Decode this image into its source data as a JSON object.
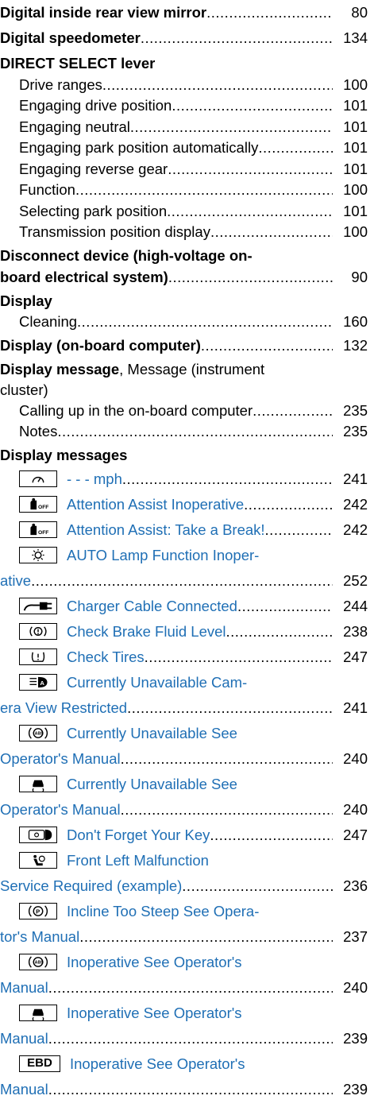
{
  "entries": [
    {
      "kind": "main",
      "parts": [
        {
          "t": "Digital inside rear view mirror",
          "b": true
        }
      ],
      "page": "80"
    },
    {
      "kind": "main",
      "parts": [
        {
          "t": "Digital speedometer",
          "b": true
        }
      ],
      "page": "134"
    },
    {
      "kind": "main",
      "parts": [
        {
          "t": "DIRECT SELECT lever",
          "b": true
        }
      ],
      "page": ""
    },
    {
      "kind": "sub",
      "parts": [
        {
          "t": "Drive ranges"
        }
      ],
      "page": "100"
    },
    {
      "kind": "sub",
      "parts": [
        {
          "t": "Engaging drive position"
        }
      ],
      "page": "101"
    },
    {
      "kind": "sub",
      "parts": [
        {
          "t": "Engaging neutral"
        }
      ],
      "page": "101"
    },
    {
      "kind": "sub",
      "parts": [
        {
          "t": "Engaging park position automatically"
        }
      ],
      "page": "101"
    },
    {
      "kind": "sub",
      "parts": [
        {
          "t": "Engaging reverse gear"
        }
      ],
      "page": "101"
    },
    {
      "kind": "sub",
      "parts": [
        {
          "t": "Function"
        }
      ],
      "page": "100"
    },
    {
      "kind": "sub",
      "parts": [
        {
          "t": "Selecting park position"
        }
      ],
      "page": "101"
    },
    {
      "kind": "sub",
      "parts": [
        {
          "t": "Transmission position display"
        }
      ],
      "page": "100"
    },
    {
      "kind": "main",
      "parts": [
        {
          "t": "Disconnect device (high-voltage on-",
          "b": true
        }
      ],
      "page": ""
    },
    {
      "kind": "main",
      "parts": [
        {
          "t": "board electrical system)",
          "b": true
        }
      ],
      "page": "90"
    },
    {
      "kind": "main",
      "parts": [
        {
          "t": "Display",
          "b": true
        }
      ],
      "page": ""
    },
    {
      "kind": "sub",
      "parts": [
        {
          "t": "Cleaning"
        }
      ],
      "page": "160"
    },
    {
      "kind": "main",
      "parts": [
        {
          "t": "Display (on-board computer)",
          "b": true
        }
      ],
      "page": "132"
    },
    {
      "kind": "main",
      "parts": [
        {
          "t": "Display message",
          "b": true
        },
        {
          "t": ", Message (instrument"
        }
      ],
      "page": ""
    },
    {
      "kind": "main",
      "parts": [
        {
          "t": "cluster)"
        }
      ],
      "page": ""
    },
    {
      "kind": "sub",
      "parts": [
        {
          "t": "Calling up in the on-board computer"
        }
      ],
      "page": "235"
    },
    {
      "kind": "sub",
      "parts": [
        {
          "t": "Notes"
        }
      ],
      "page": "235"
    },
    {
      "kind": "main",
      "parts": [
        {
          "t": "Display messages",
          "b": true
        }
      ],
      "page": ""
    },
    {
      "kind": "msg",
      "icon": "speedometer-icon",
      "parts": [
        {
          "t": "- - - mph",
          "l": true
        }
      ],
      "page": "241"
    },
    {
      "kind": "msg",
      "icon": "attention-assist-off-icon",
      "parts": [
        {
          "t": "Attention Assist Inoperative",
          "l": true
        }
      ],
      "page": "242"
    },
    {
      "kind": "msg",
      "icon": "attention-assist-off-icon",
      "parts": [
        {
          "t": "Attention Assist: Take a Break!",
          "l": true
        }
      ],
      "page": "242"
    },
    {
      "kind": "msg",
      "icon": "lamp-icon",
      "parts": [
        {
          "t": "AUTO Lamp Function Inoper-",
          "l": true
        }
      ],
      "page": ""
    },
    {
      "kind": "cont",
      "parts": [
        {
          "t": "ative",
          "l": true
        }
      ],
      "page": "252"
    },
    {
      "kind": "msg",
      "icon": "charger-plug-icon",
      "parts": [
        {
          "t": "Charger Cable Connected",
          "l": true
        }
      ],
      "page": "244"
    },
    {
      "kind": "msg",
      "icon": "brake-warning-icon",
      "parts": [
        {
          "t": "Check Brake Fluid Level",
          "l": true
        }
      ],
      "page": "238"
    },
    {
      "kind": "msg",
      "icon": "tire-pressure-icon",
      "parts": [
        {
          "t": "Check Tires",
          "l": true
        }
      ],
      "page": "247"
    },
    {
      "kind": "msg",
      "icon": "high-beam-assist-icon",
      "parts": [
        {
          "t": "Currently Unavailable Cam-",
          "l": true
        }
      ],
      "page": ""
    },
    {
      "kind": "cont",
      "parts": [
        {
          "t": "era View Restricted",
          "l": true
        }
      ],
      "page": "241"
    },
    {
      "kind": "msg",
      "icon": "abs-icon",
      "parts": [
        {
          "t": "Currently Unavailable See",
          "l": true
        }
      ],
      "page": ""
    },
    {
      "kind": "cont",
      "parts": [
        {
          "t": "Operator's Manual",
          "l": true
        }
      ],
      "page": "240"
    },
    {
      "kind": "msg",
      "icon": "skid-car-icon",
      "parts": [
        {
          "t": "Currently Unavailable See",
          "l": true
        }
      ],
      "page": ""
    },
    {
      "kind": "cont",
      "parts": [
        {
          "t": "Operator's Manual",
          "l": true
        }
      ],
      "page": "240"
    },
    {
      "kind": "msg",
      "icon": "key-icon",
      "parts": [
        {
          "t": "Don't Forget Your Key",
          "l": true
        }
      ],
      "page": "247"
    },
    {
      "kind": "msg",
      "icon": "airbag-icon",
      "parts": [
        {
          "t": "Front Left Malfunction",
          "l": true
        }
      ],
      "page": ""
    },
    {
      "kind": "cont",
      "parts": [
        {
          "t": "Service Required (example)",
          "l": true
        }
      ],
      "page": "236"
    },
    {
      "kind": "msg",
      "icon": "parking-brake-icon",
      "parts": [
        {
          "t": "Incline Too Steep See Opera-",
          "l": true
        }
      ],
      "page": ""
    },
    {
      "kind": "cont",
      "parts": [
        {
          "t": "tor's Manual",
          "l": true
        }
      ],
      "page": "237"
    },
    {
      "kind": "msg",
      "icon": "abs-icon",
      "parts": [
        {
          "t": "Inoperative See Operator's",
          "l": true
        }
      ],
      "page": ""
    },
    {
      "kind": "cont",
      "parts": [
        {
          "t": "Manual",
          "l": true
        }
      ],
      "page": "240"
    },
    {
      "kind": "msg",
      "icon": "skid-car-icon",
      "parts": [
        {
          "t": "Inoperative See Operator's",
          "l": true
        }
      ],
      "page": ""
    },
    {
      "kind": "cont",
      "parts": [
        {
          "t": "Manual",
          "l": true
        }
      ],
      "page": "239"
    },
    {
      "kind": "msg",
      "icon": "ebd-icon",
      "icon_text": "EBD",
      "parts": [
        {
          "t": "Inoperative See Operator's",
          "l": true
        }
      ],
      "page": ""
    },
    {
      "kind": "cont",
      "parts": [
        {
          "t": "Manual",
          "l": true
        }
      ],
      "page": "239"
    }
  ],
  "colors": {
    "link": "#1f6fb5",
    "text": "#000000"
  }
}
